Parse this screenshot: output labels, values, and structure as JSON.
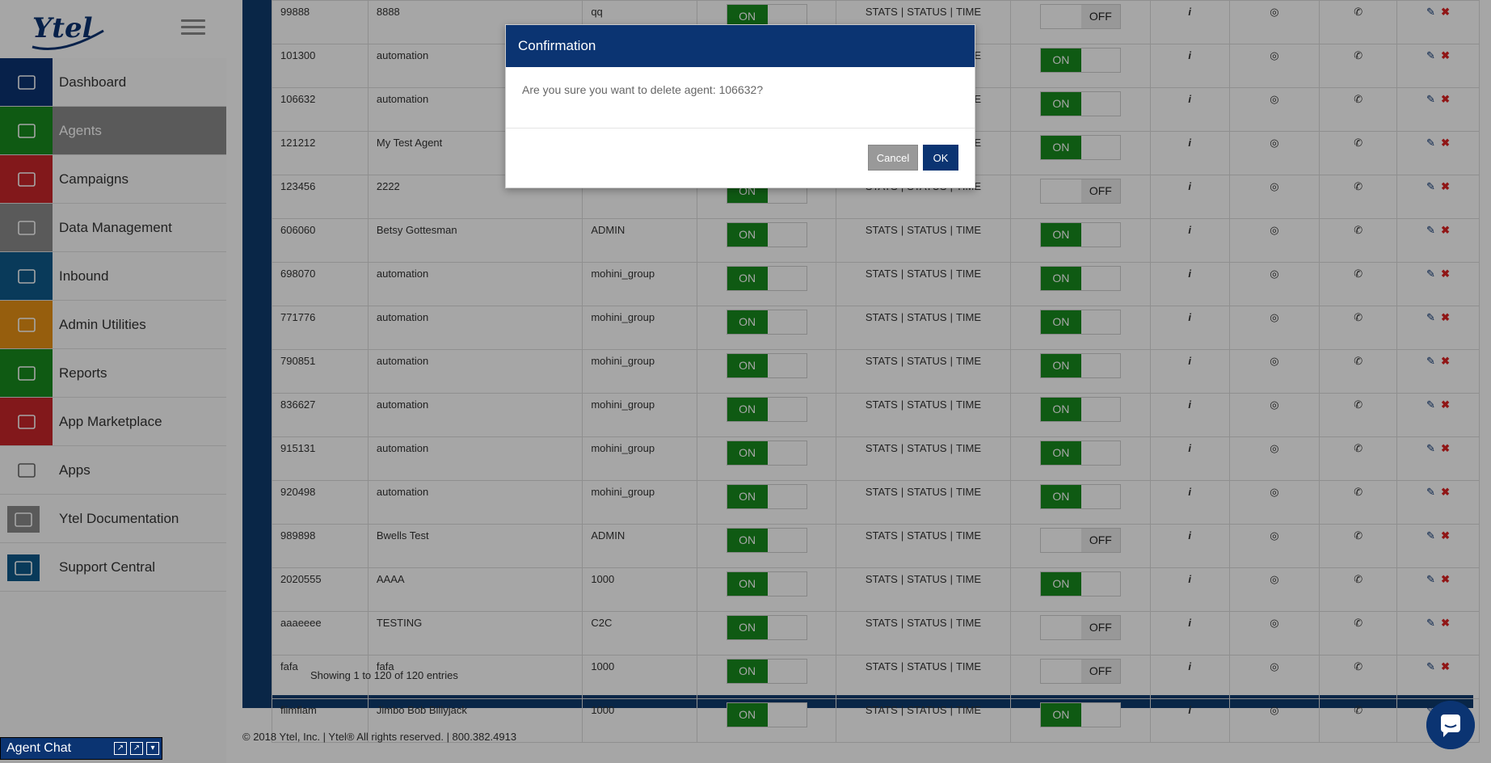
{
  "sidebar": {
    "items": [
      {
        "label": "Dashboard",
        "icon": "dashboard-icon",
        "color": "#0b3472"
      },
      {
        "label": "Agents",
        "icon": "agent-icon",
        "color": "#178a1e"
      },
      {
        "label": "Campaigns",
        "icon": "campaigns-icon",
        "color": "#c8262a"
      },
      {
        "label": "Data Management",
        "icon": "database-icon",
        "color": "#8a8a8a"
      },
      {
        "label": "Inbound",
        "icon": "inbound-icon",
        "color": "#0e5a8a"
      },
      {
        "label": "Admin Utilities",
        "icon": "admin-icon",
        "color": "#e69114"
      },
      {
        "label": "Reports",
        "icon": "reports-icon",
        "color": "#178a1e"
      },
      {
        "label": "App Marketplace",
        "icon": "marketplace-icon",
        "color": "#c8262a"
      },
      {
        "label": "Apps",
        "icon": "apps-icon",
        "color": "#fcfcfc"
      },
      {
        "label": "Ytel Documentation",
        "icon": "help-icon",
        "color": "#8a8a8a"
      },
      {
        "label": "Support Central",
        "icon": "support-icon",
        "color": "#0e5a8a"
      }
    ]
  },
  "table": {
    "rows": [
      {
        "id": "99888",
        "name": "8888",
        "group": "qq",
        "active": "ON",
        "links": [
          "STATS",
          "STATUS",
          "TIME"
        ],
        "status": "OFF"
      },
      {
        "id": "101300",
        "name": "automation",
        "group": "",
        "active": "ON",
        "links": [
          "STATS",
          "STATUS",
          "TIME"
        ],
        "status": "ON"
      },
      {
        "id": "106632",
        "name": "automation",
        "group": "",
        "active": "ON",
        "links": [
          "STATS",
          "STATUS",
          "TIME"
        ],
        "status": "ON"
      },
      {
        "id": "121212",
        "name": "My Test Agent",
        "group": "",
        "active": "ON",
        "links": [
          "STATS",
          "STATUS",
          "TIME"
        ],
        "status": "ON"
      },
      {
        "id": "123456",
        "name": "2222",
        "group": "",
        "active": "ON",
        "links": [
          "STATS",
          "STATUS",
          "TIME"
        ],
        "status": "OFF"
      },
      {
        "id": "606060",
        "name": "Betsy Gottesman",
        "group": "ADMIN",
        "active": "ON",
        "links": [
          "STATS",
          "STATUS",
          "TIME"
        ],
        "status": "ON"
      },
      {
        "id": "698070",
        "name": "automation",
        "group": "mohini_group",
        "active": "ON",
        "links": [
          "STATS",
          "STATUS",
          "TIME"
        ],
        "status": "ON"
      },
      {
        "id": "771776",
        "name": "automation",
        "group": "mohini_group",
        "active": "ON",
        "links": [
          "STATS",
          "STATUS",
          "TIME"
        ],
        "status": "ON"
      },
      {
        "id": "790851",
        "name": "automation",
        "group": "mohini_group",
        "active": "ON",
        "links": [
          "STATS",
          "STATUS",
          "TIME"
        ],
        "status": "ON"
      },
      {
        "id": "836627",
        "name": "automation",
        "group": "mohini_group",
        "active": "ON",
        "links": [
          "STATS",
          "STATUS",
          "TIME"
        ],
        "status": "ON"
      },
      {
        "id": "915131",
        "name": "automation",
        "group": "mohini_group",
        "active": "ON",
        "links": [
          "STATS",
          "STATUS",
          "TIME"
        ],
        "status": "ON"
      },
      {
        "id": "920498",
        "name": "automation",
        "group": "mohini_group",
        "active": "ON",
        "links": [
          "STATS",
          "STATUS",
          "TIME"
        ],
        "status": "ON"
      },
      {
        "id": "989898",
        "name": "Bwells Test",
        "group": "ADMIN",
        "active": "ON",
        "links": [
          "STATS",
          "STATUS",
          "TIME"
        ],
        "status": "OFF"
      },
      {
        "id": "2020555",
        "name": "AAAA",
        "group": "1000",
        "active": "ON",
        "links": [
          "STATS",
          "STATUS",
          "TIME"
        ],
        "status": "ON"
      },
      {
        "id": "aaaeeee",
        "name": "TESTING",
        "group": "C2C",
        "active": "ON",
        "links": [
          "STATS",
          "STATUS",
          "TIME"
        ],
        "status": "OFF"
      },
      {
        "id": "fafa",
        "name": "fafa",
        "group": "1000",
        "active": "ON",
        "links": [
          "STATS",
          "STATUS",
          "TIME"
        ],
        "status": "OFF"
      },
      {
        "id": "flimflam",
        "name": "Jimbo Bob Billyjack",
        "group": "1000",
        "active": "ON",
        "links": [
          "STATS",
          "STATUS",
          "TIME"
        ],
        "status": "ON"
      }
    ],
    "footer": "Showing 1 to 120 of 120 entries"
  },
  "copyright": "© 2018 Ytel, Inc. | Ytel® All rights reserved. | 800.382.4913",
  "dialog": {
    "title": "Confirmation",
    "message": "Are you sure you want to delete agent: 106632?",
    "cancel": "Cancel",
    "ok": "OK"
  },
  "agent_chat": {
    "label": "Agent Chat"
  },
  "logo": "Ytel"
}
